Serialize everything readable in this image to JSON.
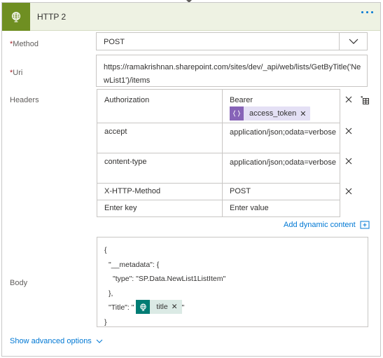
{
  "header": {
    "title": "HTTP 2",
    "accent_color": "#6f8f22",
    "icon": "globe-icon",
    "menu_icon": "more-options-icon"
  },
  "method": {
    "label": "Method",
    "required_marker": "*",
    "value": "POST",
    "dropdown_icon": "chevron-down-icon"
  },
  "uri": {
    "label": "Uri",
    "required_marker": "*",
    "value": "https://ramakrishnan.sharepoint.com/sites/dev/_api/web/lists/GetByTitle('NewList1')/items"
  },
  "headers": {
    "label": "Headers",
    "switch_icon": "text-mode-icon",
    "rows": [
      {
        "key": "Authorization",
        "value": "Bearer",
        "token": {
          "label": "access_token",
          "icon": "expression-icon",
          "color": "#8764b8"
        }
      },
      {
        "key": "accept",
        "value": "application/json;odata=verbose"
      },
      {
        "key": "content-type",
        "value": "application/json;odata=verbose"
      },
      {
        "key": "X-HTTP-Method",
        "value": "POST"
      }
    ],
    "key_placeholder": "Enter key",
    "value_placeholder": "Enter value"
  },
  "add_dynamic_content": "Add dynamic content",
  "body": {
    "label": "Body",
    "line1": "{",
    "line2": "\"__metadata\": {",
    "line3": "\"type\": \"SP.Data.NewList1ListItem\"",
    "line4": "},",
    "line5_prefix": "\"Title\": \"",
    "line5_suffix": "\"",
    "line6": "}",
    "token": {
      "label": "title",
      "icon": "globe-icon",
      "color": "#007c74"
    }
  },
  "advanced_options": "Show advanced options"
}
